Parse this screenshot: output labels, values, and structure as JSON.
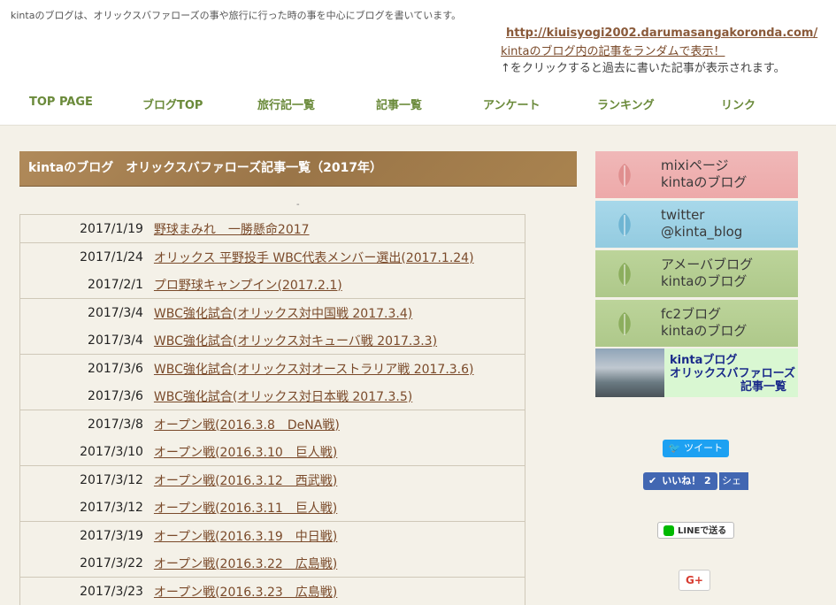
{
  "header": {
    "tagline": "kintaのブログは、オリックスバファローズの事や旅行に行った時の事を中心にブログを書いています。",
    "site_link": "http://kiuisyogi2002.darumasangakoronda.com/",
    "random_link": "kintaのブログ内の記事をランダムで表示！",
    "random_note": "↑をクリックすると過去に書いた記事が表示されます。"
  },
  "nav": {
    "items": [
      "TOP PAGE",
      "ブログTOP",
      "旅行記一覧",
      "記事一覧",
      "アンケート",
      "ランキング",
      "リンク"
    ]
  },
  "main": {
    "heading": "kintaのブログ　オリックスバファローズ記事一覧（2017年）",
    "dash": "-",
    "articles": [
      {
        "date": "2017/1/19",
        "title": "野球まみれ　一勝懸命2017"
      },
      {
        "date": "2017/1/24",
        "title": "オリックス 平野投手 WBC代表メンバー選出(2017.1.24)"
      },
      {
        "date": "2017/2/1",
        "title": "プロ野球キャンプイン(2017.2.1)"
      },
      {
        "date": "2017/3/4",
        "title": "WBC強化試合(オリックス対中国戦 2017.3.4)"
      },
      {
        "date": "2017/3/4",
        "title": "WBC強化試合(オリックス対キューバ戦 2017.3.3)"
      },
      {
        "date": "2017/3/6",
        "title": "WBC強化試合(オリックス対オーストラリア戦 2017.3.6)"
      },
      {
        "date": "2017/3/6",
        "title": "WBC強化試合(オリックス対日本戦 2017.3.5)"
      },
      {
        "date": "2017/3/8",
        "title": "オープン戦(2016.3.8　DeNA戦)"
      },
      {
        "date": "2017/3/10",
        "title": "オープン戦(2016.3.10　巨人戦)"
      },
      {
        "date": "2017/3/12",
        "title": "オープン戦(2016.3.12　西武戦)"
      },
      {
        "date": "2017/3/12",
        "title": "オープン戦(2016.3.11　巨人戦)"
      },
      {
        "date": "2017/3/19",
        "title": "オープン戦(2016.3.19　中日戦)"
      },
      {
        "date": "2017/3/22",
        "title": "オープン戦(2016.3.22　広島戦)"
      },
      {
        "date": "2017/3/23",
        "title": "オープン戦(2016.3.23　広島戦)"
      }
    ]
  },
  "sidebar": {
    "banners": [
      {
        "line1": "mixiページ",
        "line2": "kintaのブログ"
      },
      {
        "line1": "twitter",
        "line2": "@kinta_blog"
      },
      {
        "line1": "アメーバブログ",
        "line2": "kintaのブログ"
      },
      {
        "line1": "fc2ブログ",
        "line2": "kintaのブログ"
      }
    ],
    "orix_banner": {
      "line1": "kintaブログ",
      "line2": "オリックスバファローズ",
      "line3": "記事一覧"
    },
    "tweet_label": "ツイート",
    "like_label": "いいね！ 2",
    "share_label": "シェア",
    "line_label": "LINEで送る",
    "gplus_label": "G+"
  }
}
